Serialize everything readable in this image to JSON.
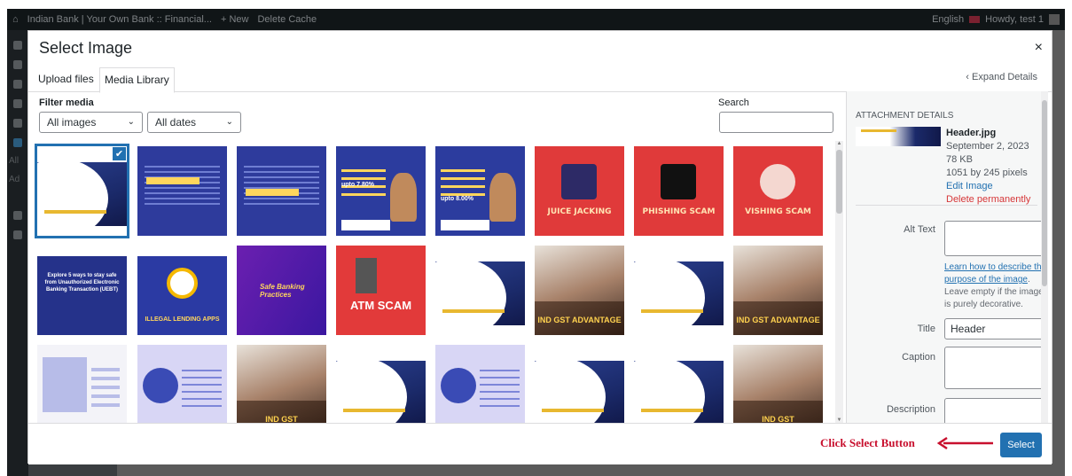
{
  "adminbar": {
    "site_name": "Indian Bank | Your Own Bank :: Financial...",
    "new_label": "+ New",
    "delete_cache": "Delete Cache",
    "language": "English",
    "howdy": "Howdy, test 1"
  },
  "admin_sidebar": {
    "text_a": "All",
    "text_b": "Ad"
  },
  "modal": {
    "title": "Select Image",
    "close_glyph": "×",
    "tabs": [
      "Upload files",
      "Media Library"
    ],
    "expand_details": "‹ Expand Details"
  },
  "filters": {
    "label": "Filter media",
    "type_selected": "All images",
    "date_selected": "All dates",
    "search_label": "Search",
    "search_value": ""
  },
  "grid": {
    "selected_index": 0,
    "check_glyph": "✔",
    "thumb_texts": {
      "juice": "JUICE JACKING",
      "phishing": "PHISHING SCAM",
      "vishing": "VISHING SCAM",
      "hmbt": "Explore 5 ways to stay safe from Unauthorized Electronic Banking Transaction (UEBT)",
      "lending": "ILLEGAL LENDING APPS",
      "safe": "Safe Banking Practices",
      "atm": "ATM SCAM",
      "gst": "IND GST ADVANTAGE",
      "gst_short": "IND GST",
      "rate1": "upto 7.80%",
      "rate2": "upto 8.00%"
    }
  },
  "attachment": {
    "heading": "ATTACHMENT DETAILS",
    "filename": "Header.jpg",
    "date": "September 2, 2023",
    "size": "78 KB",
    "dimensions": "1051 by 245 pixels",
    "edit": "Edit Image",
    "delete": "Delete permanently",
    "alt_label": "Alt Text",
    "alt_value": "",
    "help_link": "Learn how to describe the purpose of the image",
    "help_rest": ". Leave empty if the image is purely decorative.",
    "title_label": "Title",
    "title_value": "Header",
    "caption_label": "Caption",
    "description_label": "Description"
  },
  "footer": {
    "annotation": "Click Select Button",
    "select_label": "Select"
  },
  "colors": {
    "accent": "#2271b1",
    "annotation": "#c8102e",
    "danger": "#d63638"
  }
}
